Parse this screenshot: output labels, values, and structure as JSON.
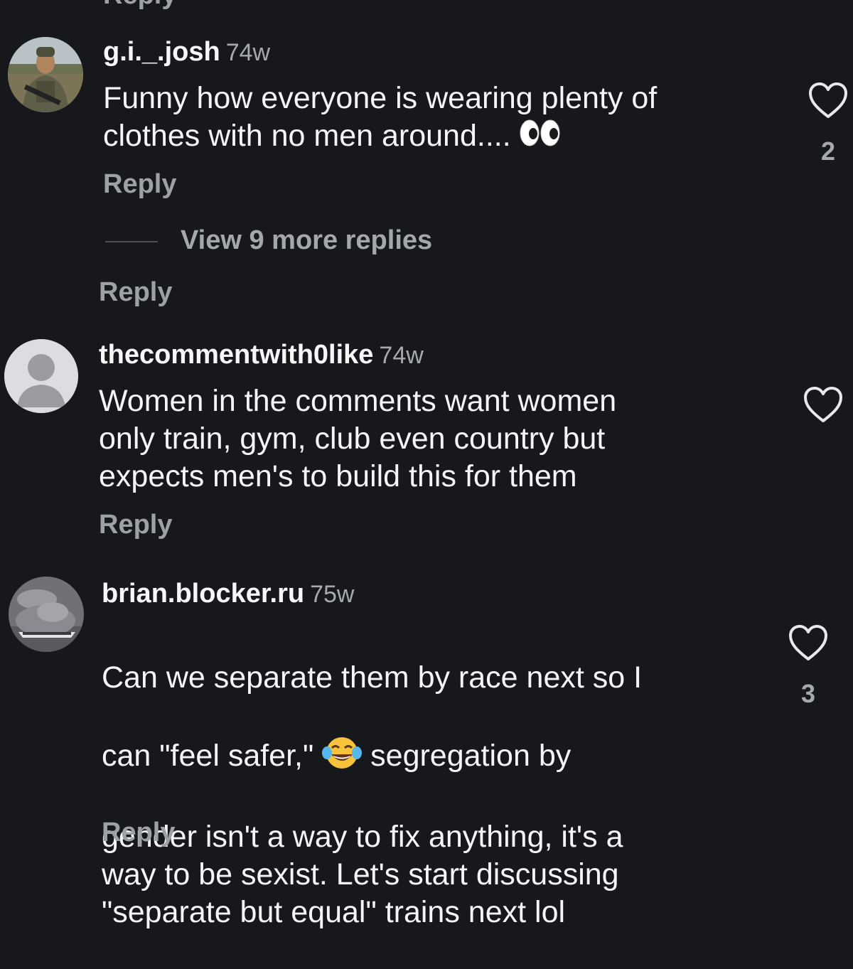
{
  "top_partial": {
    "reply_label": "Reply"
  },
  "comments": [
    {
      "username": "g.i._.josh",
      "time": "74w",
      "text_before_emoji": "Funny how everyone is wearing plenty of\nclothes with no men around.... ",
      "emoji": "eyes-emoji",
      "likes": "2",
      "reply_label": "Reply",
      "view_replies_label": "View 9 more replies",
      "thread_reply_label": "Reply"
    },
    {
      "username": "thecommentwith0like",
      "time": "74w",
      "text": "Women in the comments want women\nonly train, gym, club even country but\nexpects men's to build this for them",
      "likes": "",
      "reply_label": "Reply"
    },
    {
      "username": "brian.blocker.ru",
      "time": "75w",
      "text_line1": "Can we separate them by race next so I",
      "text_line2_before": "can \"feel safer,\" ",
      "emoji": "face-with-tears-of-joy-emoji",
      "text_line2_after": " segregation by",
      "text_rest": "gender isn't a way to fix anything, it's a\nway to be sexist. Let's start discussing\n\"separate but equal\" trains next lol",
      "likes": "3",
      "reply_label": "Reply"
    }
  ],
  "icons": {
    "heart": "heart-outline-icon",
    "default_avatar": "default-avatar-icon"
  },
  "colors": {
    "background": "#16181b",
    "primary_text": "#f4f5f6",
    "secondary_text": "#9da0a5"
  }
}
